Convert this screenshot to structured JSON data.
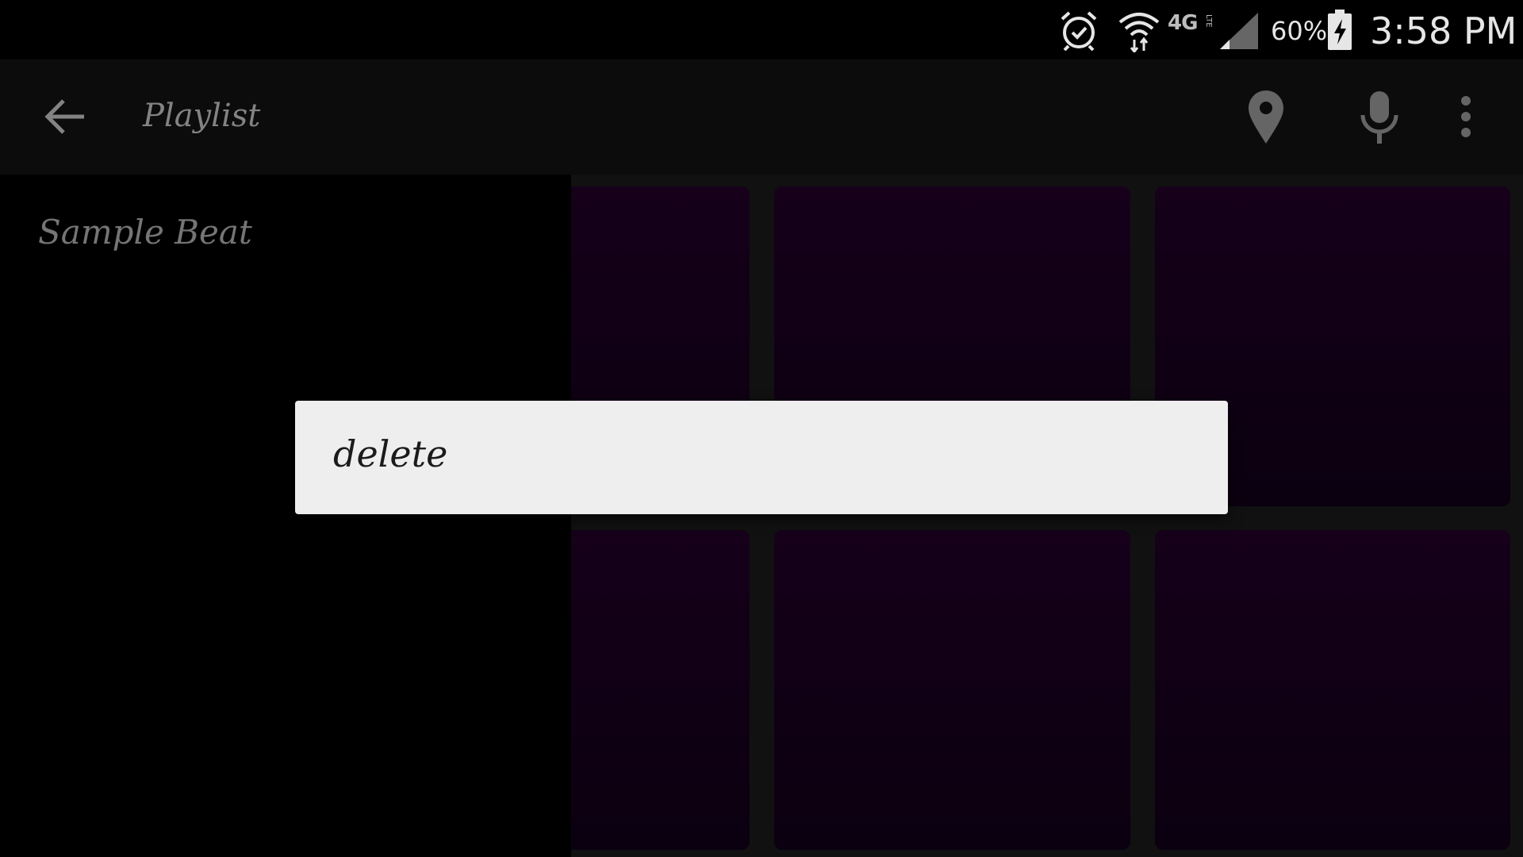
{
  "status_bar": {
    "network": "4G",
    "network_sub": "LTE",
    "battery": "60%",
    "time": "3:58 PM",
    "icons": [
      "alarm-icon",
      "wifi-icon",
      "cell-signal-icon",
      "battery-charging-icon"
    ]
  },
  "app_bar": {
    "title": "Playlist",
    "icons": [
      "back-arrow-icon",
      "location-pin-icon",
      "microphone-icon",
      "overflow-menu-icon"
    ]
  },
  "sidebar": {
    "items": [
      {
        "label": "Sample Beat"
      }
    ]
  },
  "pads": {
    "color_top": "#1a001f",
    "color_bottom": "#0d0013",
    "count": 6
  },
  "dialog": {
    "items": [
      {
        "label": "delete"
      }
    ]
  }
}
